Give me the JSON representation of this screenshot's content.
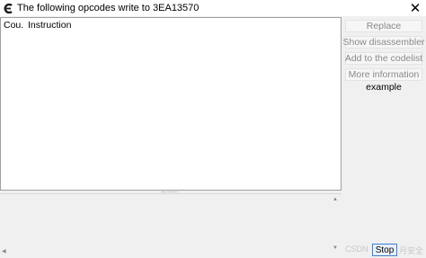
{
  "window": {
    "title": "The following opcodes write to 3EA13570",
    "close_glyph": "✕"
  },
  "list": {
    "columns": [
      "Cou...",
      "Instruction"
    ]
  },
  "side_buttons": {
    "replace": "Replace",
    "show_disassembler": "Show disassembler",
    "add_to_codelist": "Add to the codelist",
    "more_information": "More information"
  },
  "side_label": "example",
  "stop_label": "Stop",
  "watermark": {
    "left": "CSDN",
    "right": "月安全"
  },
  "colors": {
    "titlebar": "#ffffff",
    "background": "#f0f0f0",
    "disabled_text": "#8a8a8a",
    "stop_border": "#3c7fd1"
  },
  "icons": {
    "app": "cheat-engine-logo-icon",
    "close": "close-icon"
  }
}
